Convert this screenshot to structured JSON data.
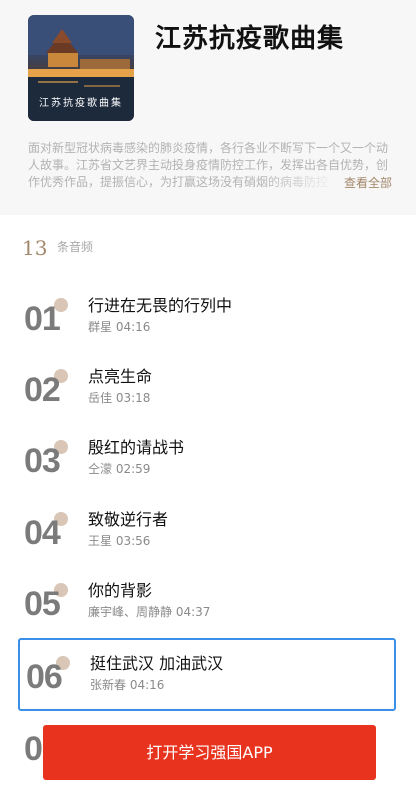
{
  "album": {
    "title": "江苏抗疫歌曲集",
    "cover_caption": "江苏抗疫歌曲集",
    "description": "面对新型冠状病毒感染的肺炎疫情，各行各业不断写下一个又一个动人故事。江苏省文艺界主动投身疫情防控工作，发挥出各自优势，创作优秀作品，提振信心，为打赢这场没有硝烟的病毒防控",
    "view_all": "查看全部"
  },
  "list": {
    "count": "13",
    "count_label": "条音频",
    "items": [
      {
        "num": "01",
        "title": "行进在无畏的行列中",
        "meta": "群星 04:16"
      },
      {
        "num": "02",
        "title": "点亮生命",
        "meta": "岳佳 03:18"
      },
      {
        "num": "03",
        "title": "殷红的请战书",
        "meta": "仝濛 02:59"
      },
      {
        "num": "04",
        "title": "致敬逆行者",
        "meta": "王星 03:56"
      },
      {
        "num": "05",
        "title": "你的背影",
        "meta": "廉宇峰、周静静 04:37"
      },
      {
        "num": "06",
        "title": "挺住武汉 加油武汉",
        "meta": "张新春 04:16"
      }
    ],
    "partial_num": "0"
  },
  "cta": {
    "label": "打开学习强国APP",
    "color": "#e8341f"
  }
}
